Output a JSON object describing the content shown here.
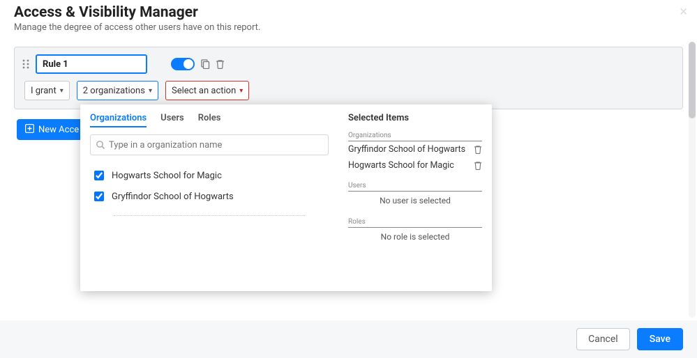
{
  "header": {
    "title": "Access & Visibility Manager",
    "subtitle": "Manage the degree of access other users have on this report."
  },
  "rule": {
    "name": "Rule 1",
    "enabled": true,
    "grant_label": "I grant",
    "scope_label": "2 organizations",
    "action_label": "Select an action"
  },
  "new_rule_label": "New Acce",
  "popover": {
    "tabs": {
      "organizations": "Organizations",
      "users": "Users",
      "roles": "Roles",
      "active": "organizations"
    },
    "search_placeholder": "Type in a organization name",
    "options": [
      {
        "label": "Hogwarts School for Magic",
        "checked": true
      },
      {
        "label": "Gryffindor School of Hogwarts",
        "checked": true
      }
    ],
    "selected_heading": "Selected Items",
    "groups": {
      "organizations": {
        "label": "Organizations",
        "items": [
          "Gryffindor School of Hogwarts",
          "Hogwarts School for Magic"
        ]
      },
      "users": {
        "label": "Users",
        "empty": "No user is selected"
      },
      "roles": {
        "label": "Roles",
        "empty": "No role is selected"
      }
    }
  },
  "footer": {
    "cancel": "Cancel",
    "save": "Save"
  }
}
